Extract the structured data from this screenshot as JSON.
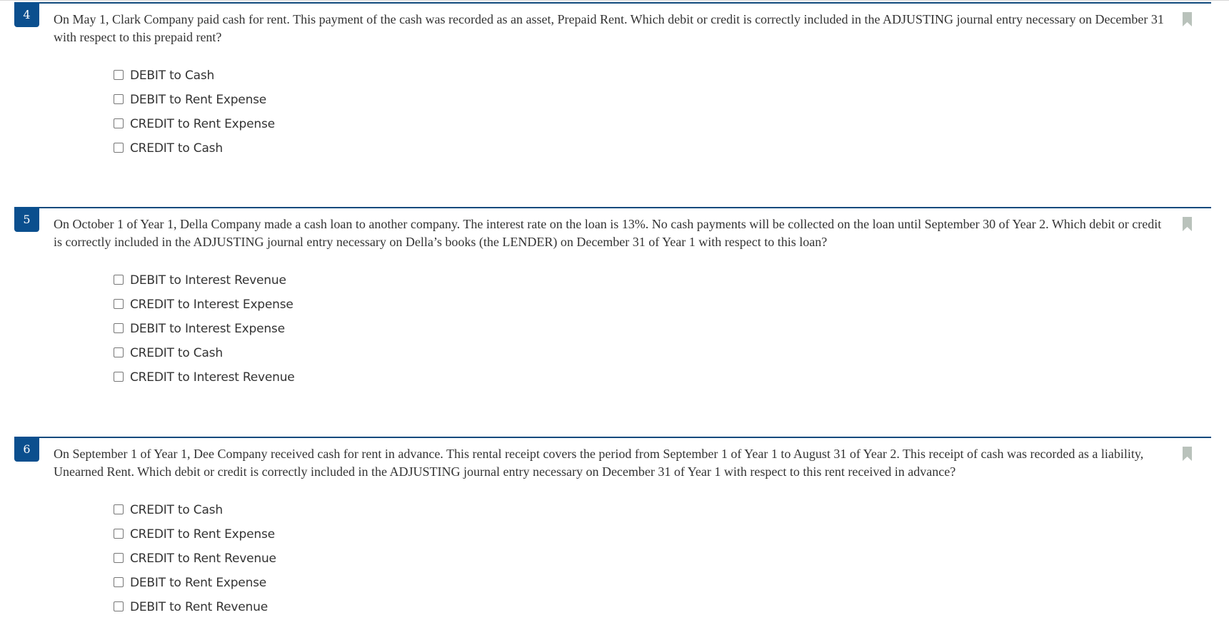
{
  "questions": [
    {
      "number": "4",
      "text": "On May 1, Clark Company paid cash for rent. This payment of the cash was recorded as an asset, Prepaid Rent. Which debit or credit is correctly included in the ADJUSTING journal entry necessary on December 31 with respect to this prepaid rent?",
      "bookmark_icon": "bookmark-icon",
      "options": [
        {
          "label": "DEBIT to Cash",
          "checked": false
        },
        {
          "label": "DEBIT to Rent Expense",
          "checked": false
        },
        {
          "label": "CREDIT to Rent Expense",
          "checked": false
        },
        {
          "label": "CREDIT to Cash",
          "checked": false
        }
      ]
    },
    {
      "number": "5",
      "text": "On October 1 of Year 1, Della Company made a cash loan to another company. The interest rate on the loan is 13%. No cash payments will be collected on the loan until September 30 of Year 2. Which debit or credit is correctly included in the ADJUSTING journal entry necessary on Della’s books (the LENDER) on December 31 of Year 1 with respect to this loan?",
      "bookmark_icon": "bookmark-icon",
      "options": [
        {
          "label": "DEBIT to Interest Revenue",
          "checked": false
        },
        {
          "label": "CREDIT to Interest Expense",
          "checked": false
        },
        {
          "label": "DEBIT to Interest Expense",
          "checked": false
        },
        {
          "label": "CREDIT to Cash",
          "checked": false
        },
        {
          "label": "CREDIT to Interest Revenue",
          "checked": false
        }
      ]
    },
    {
      "number": "6",
      "text": "On September 1 of Year 1, Dee Company received cash for rent in advance. This rental receipt covers the period from September 1 of Year 1 to August 31 of Year 2. This receipt of cash was recorded as a liability, Unearned Rent. Which debit or credit is correctly included in the ADJUSTING journal entry necessary on December 31 of Year 1 with respect to this rent received in advance?",
      "bookmark_icon": "bookmark-icon",
      "options": [
        {
          "label": "CREDIT to Cash",
          "checked": false
        },
        {
          "label": "CREDIT to Rent Expense",
          "checked": false
        },
        {
          "label": "CREDIT to Rent Revenue",
          "checked": false
        },
        {
          "label": "DEBIT to Rent Expense",
          "checked": false
        },
        {
          "label": "DEBIT to Rent Revenue",
          "checked": false
        }
      ]
    }
  ],
  "colors": {
    "badge": "#0b4f8e",
    "rule": "#114a7d",
    "bookmark": "#b9c2bb",
    "text": "#333333"
  }
}
